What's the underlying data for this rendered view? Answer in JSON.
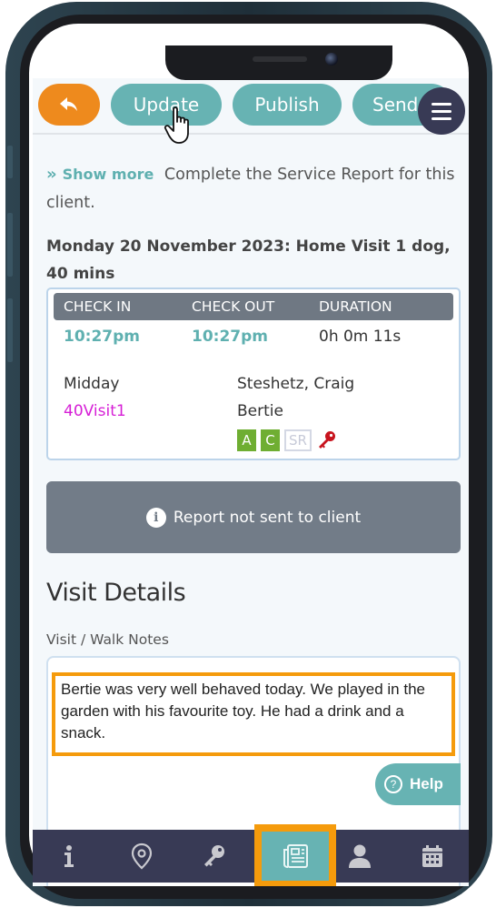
{
  "toolbar": {
    "back_icon": "reply-arrow-icon",
    "buttons": [
      {
        "label": "Update"
      },
      {
        "label": "Publish"
      },
      {
        "label": "Send"
      }
    ],
    "menu_icon": "hamburger-icon"
  },
  "intro": {
    "show_more_label": "Show more",
    "text": "Complete the Service Report for this client."
  },
  "visit": {
    "title": "Monday 20 November 2023: Home Visit 1 dog, 40 mins",
    "headers": [
      "CHECK IN",
      "CHECK OUT",
      "DURATION"
    ],
    "check_in": "10:27pm",
    "check_out": "10:27pm",
    "duration": "0h 0m 11s",
    "time_slot": "Midday",
    "service_code": "40Visit1",
    "client_name": "Steshetz, Craig",
    "pet_name": "Bertie",
    "tags": [
      "A",
      "C",
      "SR"
    ],
    "tag_colors": {
      "active": "#6fae32",
      "inactive": "#c7cad8"
    },
    "key_icon": "key-icon"
  },
  "status": {
    "text": "Report not sent to client"
  },
  "details": {
    "section_title": "Visit Details",
    "notes_label": "Visit / Walk Notes",
    "notes_value": "Bertie was very well behaved today. We played in the garden with his favourite toy. He had a drink and a snack."
  },
  "help": {
    "label": "Help"
  },
  "bottom_nav": {
    "items": [
      {
        "icon": "info-icon"
      },
      {
        "icon": "map-pin-icon"
      },
      {
        "icon": "key-icon"
      },
      {
        "icon": "newspaper-icon",
        "active": true
      },
      {
        "icon": "user-icon"
      },
      {
        "icon": "calendar-icon"
      }
    ]
  },
  "colors": {
    "accent_teal": "#67b3b3",
    "back_orange": "#ee8a1d",
    "highlight_orange": "#f59b0c",
    "nav_dark": "#383a55",
    "status_grey": "#727c88",
    "service_code_magenta": "#d620d6"
  }
}
